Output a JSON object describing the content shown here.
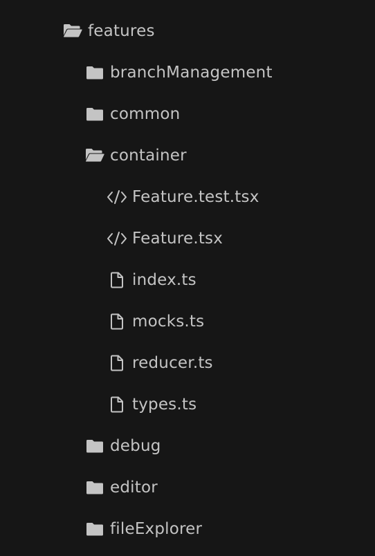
{
  "tree": {
    "root": {
      "label": "features",
      "icon": "folder-open-icon"
    },
    "branchManagement": {
      "label": "branchManagement",
      "icon": "folder-icon"
    },
    "common": {
      "label": "common",
      "icon": "folder-icon"
    },
    "container": {
      "label": "container",
      "icon": "folder-open-icon",
      "children": {
        "feature_test": {
          "label": "Feature.test.tsx",
          "icon": "code-file-icon"
        },
        "feature": {
          "label": "Feature.tsx",
          "icon": "code-file-icon"
        },
        "index": {
          "label": "index.ts",
          "icon": "file-icon"
        },
        "mocks": {
          "label": "mocks.ts",
          "icon": "file-icon"
        },
        "reducer": {
          "label": "reducer.ts",
          "icon": "file-icon"
        },
        "types": {
          "label": "types.ts",
          "icon": "file-icon"
        }
      }
    },
    "debug": {
      "label": "debug",
      "icon": "folder-icon"
    },
    "editor": {
      "label": "editor",
      "icon": "folder-icon"
    },
    "fileExplorer": {
      "label": "fileExplorer",
      "icon": "folder-icon"
    }
  },
  "colors": {
    "background": "#161616",
    "text": "#c4c4c4",
    "icon": "#c4c4c4"
  }
}
